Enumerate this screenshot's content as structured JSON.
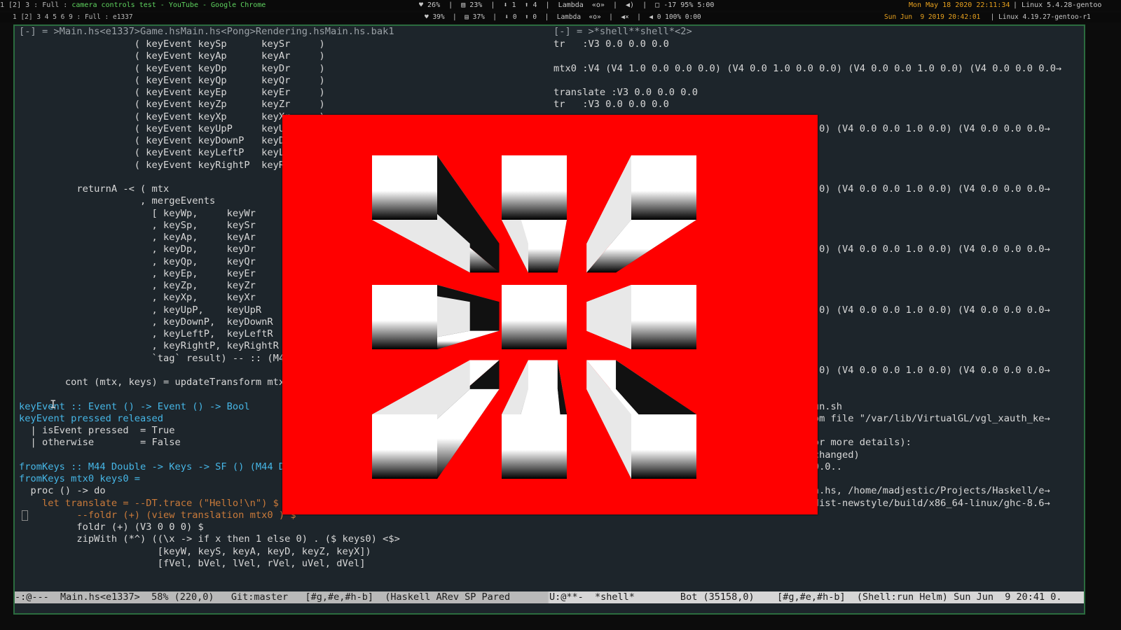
{
  "topbar": {
    "workspace_left": "1 [2] 3 : Full : ",
    "window_title": "camera controls test - YouTube - Google Chrome",
    "status_center": "♥ 26%  |  ▤ 23%  |  ⬇ 1  ⬆ 4  |  Lambda  «o»  |  ◀)  |  □ -17 95% 5:00",
    "clock": "Mon May 18 2020 22:11:34",
    "kernel": " | Linux 5.4.28-gentoo"
  },
  "innerbar": {
    "workspace": "1 [2] 3 4 5 6 9 : Full : e1337",
    "status_center": "♥ 39%  |  ▤ 37%  |  ⬇ 0  ⬆ 0  |  Lambda  «o»  |  ◀×  |  ◀ 0 100% 0:00",
    "clock": "Sun Jun  9 2019 20:42:01",
    "kernel": " | Linux 4.19.27-gentoo-r1"
  },
  "editor": {
    "left_header": "[-] = >Main.hs<e1337>Game.hsMain.hs<Pong>Rendering.hsMain.hs.bak1",
    "right_header": "[-] = >*shell**shell*<2>",
    "left_lines": [
      "                    ( keyEvent keySp      keySr     )",
      "                    ( keyEvent keyAp      keyAr     )",
      "                    ( keyEvent keyDp      keyDr     )",
      "                    ( keyEvent keyQp      keyQr     )",
      "                    ( keyEvent keyEp      keyEr     )",
      "                    ( keyEvent keyZp      keyZr     )",
      "                    ( keyEvent keyXp      keyXr     )",
      "                    ( keyEvent keyUpP     keyUpR    )",
      "                    ( keyEvent keyDownP   keyDownR  )",
      "                    ( keyEvent keyLeftP   keyLeftR  )",
      "                    ( keyEvent keyRightP  keyRightR )",
      "",
      "          returnA -< ( mtx",
      "                     , mergeEvents",
      "                       [ keyWp,     keyWr",
      "                       , keySp,     keySr",
      "                       , keyAp,     keyAr",
      "                       , keyDp,     keyDr",
      "                       , keyQp,     keyQr",
      "                       , keyEp,     keyEr",
      "                       , keyZp,     keyZr",
      "                       , keyXp,     keyXr",
      "                       , keyUpP,    keyUpR",
      "                       , keyDownP,  keyDownR",
      "                       , keyLeftP,  keyLeftR",
      "                       , keyRightP, keyRightR",
      "                       `tag` result) -- :: (M44 Double, Event ())",
      "",
      "        cont (mtx, keys) = updateTransform mtx keys",
      "",
      "keyEvent :: Event () -> Event () -> Bool",
      "keyEvent pressed released",
      "  | isEvent pressed  = True",
      "  | otherwise        = False",
      "",
      "fromKeys :: M44 Double -> Keys -> SF () (M44 Double)",
      "fromKeys mtx0 keys0 =",
      "  proc () -> do",
      "    let translate = --DT.trace (\"Hello!\\n\") $",
      "          --foldr (+) (view translation mtx0 ) $",
      "          foldr (+) (V3 0 0 0) $",
      "          zipWith (*^) ((\\x -> if x then 1 else 0) . ($ keys0) <$>",
      "                        [keyW, keyS, keyA, keyD, keyZ, keyX])",
      "                        [fVel, bVel, lVel, rVel, uVel, dVel]"
    ],
    "right_lines": [
      "tr   :V3 0.0 0.0 0.0",
      "",
      "mtx0 :V4 (V4 1.0 0.0 0.0 0.0) (V4 0.0 1.0 0.0 0.0) (V4 0.0 0.0 1.0 0.0) (V4 0.0 0.0 0.0→",
      "",
      "translate :V3 0.0 0.0 0.0",
      "tr   :V3 0.0 0.0 0.0",
      "",
      "                                          0 0.0) (V4 0.0 0.0 1.0 0.0) (V4 0.0 0.0 0.0→",
      "",
      "",
      "",
      "",
      "                                          0 0.0) (V4 0.0 0.0 1.0 0.0) (V4 0.0 0.0 0.0→",
      "",
      "",
      "",
      "",
      "                                          0 0.0) (V4 0.0 0.0 1.0 0.0) (V4 0.0 0.0 0.0→",
      "",
      "",
      "",
      "",
      "                                          0 0.0) (V4 0.0 0.0 1.0 0.0) (V4 0.0 0.0 0.0→",
      "",
      "",
      "",
      "",
      "                                          0 0.0) (V4 0.0 0.0 1.0 0.0) (V4 0.0 0.0 0.0→",
      "",
      "",
      "                                          ./run.sh",
      "                                           from file \"/var/lib/VirtualGL/vgl_xauth_ke→",
      "",
      "                                          v for more details):",
      "                                          hs changed)",
      "                                          .1.0.0..",
      "                                          0..",
      "                                          Main.hs, /home/madjestic/Projects/Haskell/e→",
      "                                          37/dist-newstyle/build/x86_64-linux/ghc-8.6→"
    ],
    "modeline_left": "-:@---  Main.hs<e1337>  58% (220,0)   Git:master   [#g,#e,#h-b]  (Haskell ARev SP Pared",
    "modeline_right": "U:@**-  *shell*        Bot (35158,0)    [#g,#e,#h-b]  (Shell:run Helm) Sun Jun  9 20:41 0."
  },
  "game_window": {
    "background_color": "#ff0000",
    "scene": "fractal-textured-cubes"
  }
}
